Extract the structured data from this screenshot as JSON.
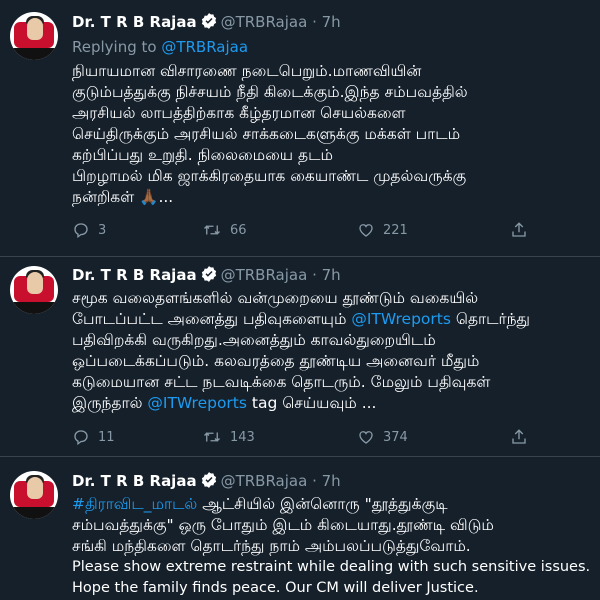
{
  "tweets": [
    {
      "name": "Dr. T R B Rajaa",
      "handle": "@TRBRajaa",
      "time": "· 7h",
      "reply_prefix": "Replying to ",
      "reply_to": "@TRBRajaa",
      "lines": [
        "நியாயமான விசாரணை நடைபெறும்.மாணவியின்",
        "குடும்பத்துக்கு நிச்சயம் நீதி கிடைக்கும்.இந்த சம்பவத்தில்",
        "அரசியல் லாபத்திற்காக கீழ்தரமான செயல்களை",
        "செய்திருக்கும் அரசியல் சாக்கடைகளுக்கு மக்கள் பாடம்",
        "கற்பிப்பது உறுதி. நிலைமையை தடம்",
        "பிறழாமல் மிக ஜாக்கிரதையாக கையாண்ட முதல்வருக்கு",
        "நன்றிகள் 🙏🏾..."
      ],
      "replies": "3",
      "retweets": "66",
      "likes": "221"
    },
    {
      "name": "Dr. T R B Rajaa",
      "handle": "@TRBRajaa",
      "time": "· 7h",
      "lines": [
        "சமூக வலைதளங்களில் வன்முறையை தூண்டும் வகையில்",
        "போடப்பட்ட அனைத்து பதிவுகளையும் ",
        "பதிவிறக்கி வருகிறது.அனைத்தும் காவல்துறையிடம்",
        "ஒப்படைக்கப்படும். கலவரத்தை தூண்டிய அனைவர் மீதும்",
        "கடுமையான சட்ட நடவடிக்கை தொடரும். மேலும் பதிவுகள்",
        "இருந்தால் "
      ],
      "link": "@ITWreports",
      "line2_after": " தொடர்ந்து",
      "line6_after": " tag செய்யவும் ...",
      "replies": "11",
      "retweets": "143",
      "likes": "374"
    },
    {
      "name": "Dr. T R B Rajaa",
      "handle": "@TRBRajaa",
      "time": "· 7h",
      "hashtag": "#திராவிட_மாடல்",
      "line1_after": " ஆட்சியில் இன்னொரு \"தூத்துக்குடி",
      "lines": [
        "சம்பவத்துக்கு\" ஒரு போதும் இடம் கிடையாது.தூண்டி விடும்",
        "சங்கி மந்திகளை தொடர்ந்து நாம் அம்பலப்படுத்துவோம்.",
        "Please show extreme restraint while dealing with such sensitive issues.",
        "Hope the family finds peace. Our CM will deliver Justice."
      ]
    }
  ],
  "colors": {
    "background": "#15202b",
    "link": "#1d9bf0",
    "muted": "#8899a6",
    "divider": "#38444d"
  },
  "icons": {
    "reply": "reply-icon",
    "retweet": "retweet-icon",
    "like": "heart-icon",
    "share": "share-icon",
    "verified": "verified-badge-icon"
  }
}
